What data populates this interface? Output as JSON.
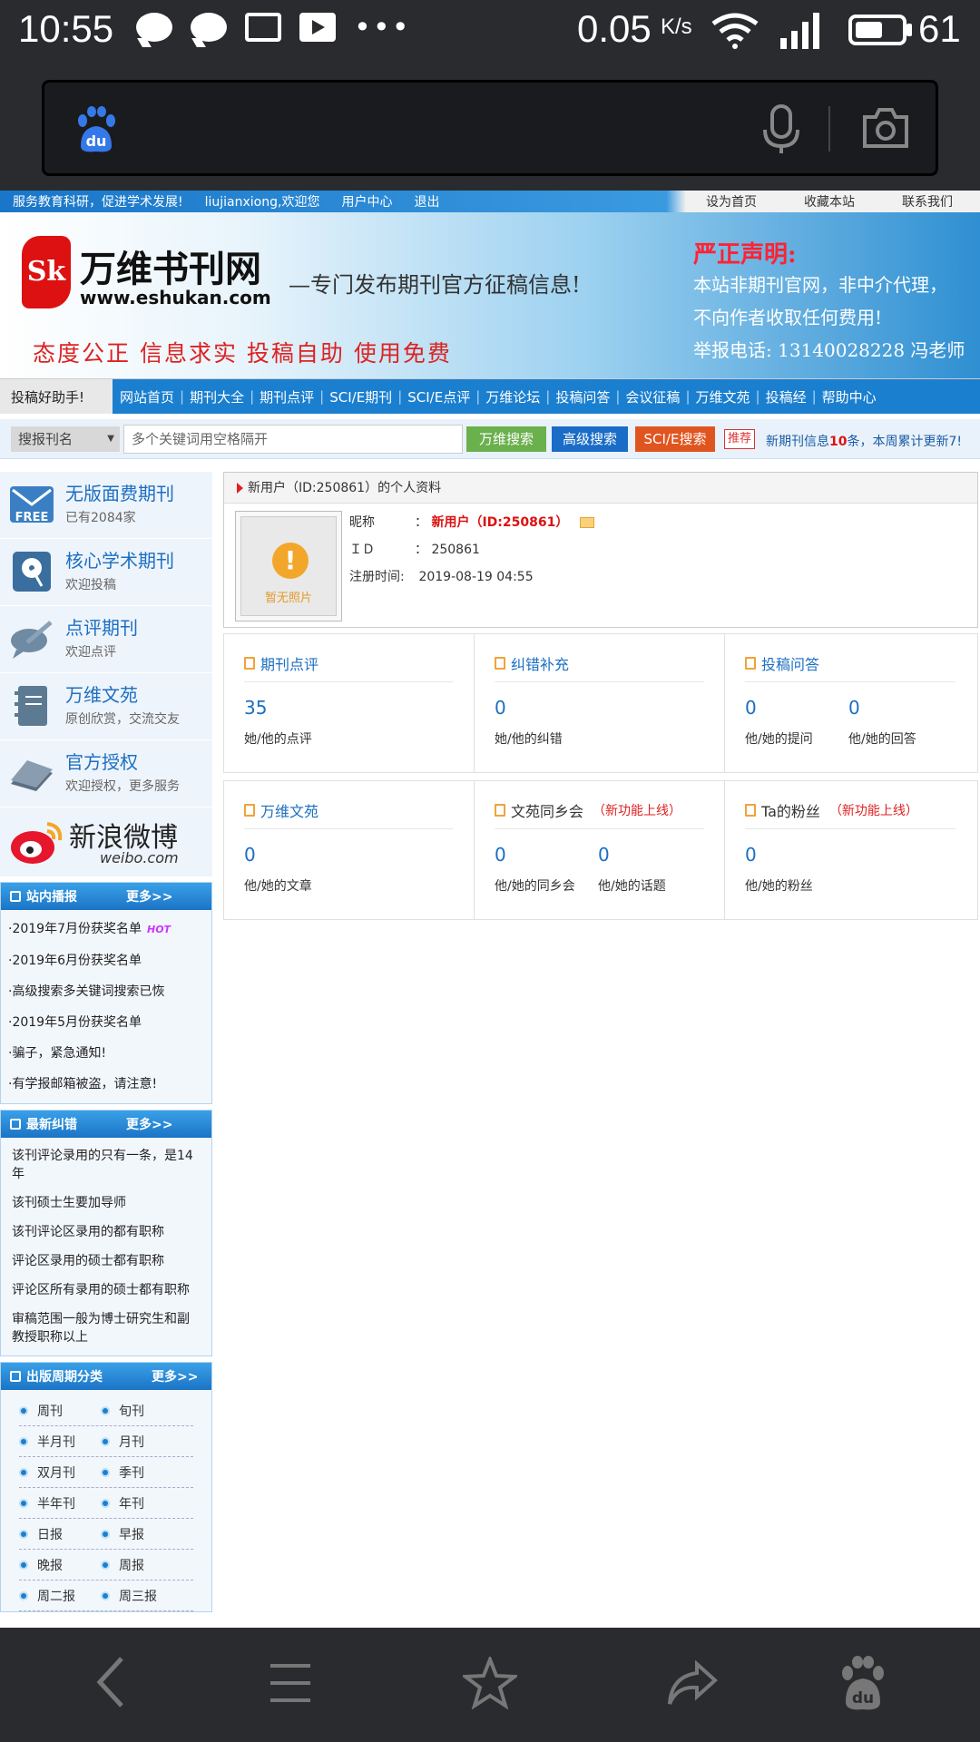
{
  "status": {
    "time": "10:55",
    "speed": "0.05",
    "speed_unit": "K/s",
    "battery": "61",
    "battery_fraction": 0.61
  },
  "page": {
    "topstrip": {
      "slogan": "服务教育科研，促进学术发展!",
      "welcome": "liujianxiong,欢迎您",
      "user_center": "用户中心",
      "logout": "退出",
      "set_home": "设为首页",
      "bookmark": "收藏本站",
      "contact": "联系我们"
    },
    "banner": {
      "logo_mark": "Sk",
      "site_name": "万维书刊网",
      "site_url": "www.eshukan.com",
      "slogan": "—专门发布期刊官方征稿信息!",
      "motto": "态度公正  信息求实  投稿自助  使用免费",
      "notice_title": "严正声明:",
      "notice_lines": [
        "本站非期刊官网，非中介代理，",
        "不向作者收取任何费用!",
        "举报电话: 13140028228 冯老师"
      ]
    },
    "nav": {
      "assistant": "投稿好助手!",
      "items": [
        "网站首页",
        "期刊大全",
        "期刊点评",
        "SCI/E期刊",
        "SCI/E点评",
        "万维论坛",
        "投稿问答",
        "会议征稿",
        "万维文苑",
        "投稿经",
        "帮助中心"
      ]
    },
    "search": {
      "select_value": "搜报刊名",
      "placeholder": "多个关键词用空格隔开",
      "btn_wanwei": "万维搜索",
      "btn_advanced": "高级搜索",
      "btn_sci": "SCI/E搜索",
      "recommend": "推荐",
      "marquee_pre": "新期刊信息",
      "marquee_count": "10",
      "marquee_post": "条，本周累计更新7!"
    },
    "sidebar": {
      "features": [
        {
          "title": "无版面费期刊",
          "sub": "已有2084家",
          "icon": "free-mail-icon"
        },
        {
          "title": "核心学术期刊",
          "sub": "欢迎投稿",
          "icon": "disk-icon"
        },
        {
          "title": "点评期刊",
          "sub": "欢迎点评",
          "icon": "comment-pen-icon"
        },
        {
          "title": "万维文苑",
          "sub": "原创欣赏，交流交友",
          "icon": "notebook-icon"
        },
        {
          "title": "官方授权",
          "sub": "欢迎授权，更多服务",
          "icon": "book-icon"
        }
      ],
      "weibo": {
        "name": "新浪微博",
        "url": "weibo.com"
      },
      "news": {
        "title": "站内播报",
        "more": "更多>>",
        "items": [
          "·2019年7月份获奖名单",
          "·2019年6月份获奖名单",
          "·高级搜索多关键词搜索已恢",
          "·2019年5月份获奖名单",
          "·骗子，紧急通知!",
          "·有学报邮箱被盗，请注意!"
        ],
        "hot": "HOT"
      },
      "corrections": {
        "title": "最新纠错",
        "more": "更多>>",
        "items": [
          "该刊评论录用的只有一条，是14年",
          "该刊硕士生要加导师",
          "该刊评论区录用的都有职称",
          "评论区录用的硕士都有职称",
          "评论区所有录用的硕士都有职称",
          "审稿范围一般为博士研究生和副教授职称以上"
        ]
      },
      "periods": {
        "title": "出版周期分类",
        "more": "更多>>",
        "rows": [
          [
            "周刊",
            "旬刊"
          ],
          [
            "半月刊",
            "月刊"
          ],
          [
            "双月刊",
            "季刊"
          ],
          [
            "半年刊",
            "年刊"
          ],
          [
            "日报",
            "早报"
          ],
          [
            "晚报",
            "周报"
          ],
          [
            "周二报",
            "周三报"
          ]
        ]
      }
    },
    "profile": {
      "header": "新用户（ID:250861）的个人资料",
      "photo_text": "暂无照片",
      "nick_label": "昵称",
      "nick_value": "新用户（ID:250861）",
      "id_label": "ＩＤ",
      "id_value": "250861",
      "reg_label": "注册时间:",
      "reg_value": "2019-08-19 04:55",
      "colon": "："
    },
    "stats": [
      {
        "title": "期刊点评",
        "new": "",
        "cols": [
          {
            "num": "35",
            "label": "她/他的点评"
          }
        ]
      },
      {
        "title": "纠错补充",
        "new": "",
        "cols": [
          {
            "num": "0",
            "label": "她/他的纠错"
          }
        ]
      },
      {
        "title": "投稿问答",
        "new": "",
        "cols": [
          {
            "num": "0",
            "label": "他/她的提问"
          },
          {
            "num": "0",
            "label": "他/她的回答"
          }
        ]
      },
      {
        "title": "万维文苑",
        "new": "",
        "cols": [
          {
            "num": "0",
            "label": "他/她的文章"
          }
        ]
      },
      {
        "title": "文苑同乡会",
        "new": "（新功能上线）",
        "cols": [
          {
            "num": "0",
            "label": "他/她的同乡会"
          },
          {
            "num": "0",
            "label": "他/她的话题"
          }
        ]
      },
      {
        "title": "Ta的粉丝",
        "new": "（新功能上线）",
        "cols": [
          {
            "num": "0",
            "label": "他/她的粉丝"
          }
        ]
      }
    ]
  },
  "colors": {
    "dark": "#2a2b2f",
    "blue": "#1b7fd0",
    "red": "#d11111",
    "link": "#1c6fc2"
  }
}
